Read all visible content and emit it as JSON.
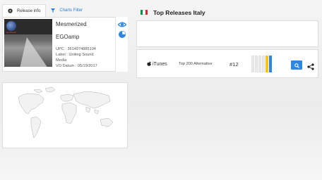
{
  "tabs": [
    {
      "label": "Release info",
      "icon": "disc-icon"
    },
    {
      "label": "Charts Filter",
      "icon": "filter-icon"
    }
  ],
  "release": {
    "title": "Mesmerized",
    "artist": "EGOamp",
    "upc": "UPC : 3614974885104",
    "label_line1": "Label : Uniting Sound",
    "label_line2": "Media",
    "vo_datum": "VO Datum : 05/19/2017",
    "cover_text": "EGOAMP"
  },
  "side_icons": [
    "eye-icon",
    "pie-chart-icon"
  ],
  "country": {
    "name": "Top Releases Italy",
    "flag_colors": [
      "#009246",
      "#ffffff",
      "#ce2b37"
    ]
  },
  "chart_entries": [
    {
      "store": "iTunes",
      "chart": "Top 200 Alternative",
      "position": "#12"
    }
  ],
  "colors": {
    "accent": "#2e86de",
    "bar_yellow": "#f5c518",
    "link": "#2a7ed6"
  }
}
